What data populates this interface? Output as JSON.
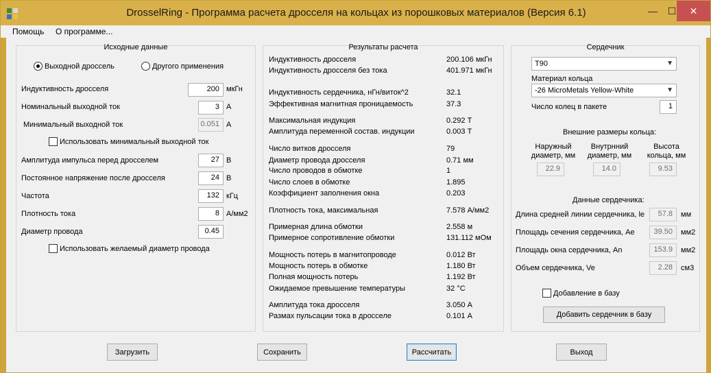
{
  "window": {
    "title": "DrosselRing - Программа расчета дросселя на кольцах из порошковых материалов (Версия 6.1)"
  },
  "menu": [
    "Помощь",
    "О программе..."
  ],
  "input": {
    "title": "Исходные данные",
    "radio_output": "Выходной дроссель",
    "radio_other": "Другого применения",
    "inductance_label": "Индуктивность  дросселя",
    "inductance_value": "200",
    "inductance_unit": "мкГн",
    "nom_current_label": "Номинальный выходной ток",
    "nom_current_value": "3",
    "nom_current_unit": "А",
    "min_current_label": "Минимальный выходной ток",
    "min_current_value": "0.051",
    "min_current_unit": "А",
    "use_min_current": "Использовать минимальный выходной ток",
    "pulse_amp_label": "Амплитуда импульса перед дросселем",
    "pulse_amp_value": "27",
    "pulse_amp_unit": "В",
    "dc_voltage_label": "Постоянное напряжение после дросселя",
    "dc_voltage_value": "24",
    "dc_voltage_unit": "В",
    "freq_label": "Частота",
    "freq_value": "132",
    "freq_unit": "кГц",
    "density_label": "Плотность тока",
    "density_value": "8",
    "density_unit": "А/мм2",
    "wire_label": "Диаметр провода",
    "wire_value": "0.45",
    "use_wire": "Использовать желаемый диаметр провода"
  },
  "results": {
    "title": "Результаты расчета",
    "rows": [
      {
        "label": "Индуктивность дросселя",
        "value": "200.106 мкГн"
      },
      {
        "label": "Индуктивность дросселя без тока",
        "value": "401.971 мкГн"
      },
      {
        "label": "Индуктивность сердечника, нГн/виток^2",
        "value": "32.1"
      },
      {
        "label": "Эффективная магнитная проницаемость",
        "value": "37.3"
      },
      {
        "label": "Максимальная индукция",
        "value": "0.292 Т"
      },
      {
        "label": "Амплитуда переменной состав. индукции",
        "value": "0.003 Т"
      },
      {
        "label": "Число витков дросселя",
        "value": "79"
      },
      {
        "label": "Диаметр провода дросселя",
        "value": "0.71 мм"
      },
      {
        "label": "Число проводов в обмотке",
        "value": "1"
      },
      {
        "label": "Число слоев в обмотке",
        "value": "1.895"
      },
      {
        "label": "Коэффициент заполнения окна",
        "value": "0.203"
      },
      {
        "label": "Плотность тока, максимальная",
        "value": "7.578 А/мм2"
      },
      {
        "label": "Примерная длина обмотки",
        "value": "2.558 м"
      },
      {
        "label": "Примерное сопротивление обмотки",
        "value": "131.112 мОм"
      },
      {
        "label": "Мощность потерь в магнитопроводе",
        "value": "0.012 Вт"
      },
      {
        "label": "Мощность потерь в обмотке",
        "value": "1.180 Вт"
      },
      {
        "label": "Полная мощность потерь",
        "value": "1.192 Вт"
      },
      {
        "label": "Ожидаемое превышение температуры",
        "value": "32 °C"
      },
      {
        "label": "Амплитуда тока дросселя",
        "value": "3.050 А"
      },
      {
        "label": "Размах пульсации тока в дросселе",
        "value": "0.101 А"
      }
    ]
  },
  "core": {
    "title": "Сердечник",
    "core_select": "T90",
    "material_label": "Материал кольца",
    "material_select": "-26 MicroMetals Yellow-White",
    "rings_label": "Число колец в пакете",
    "rings_value": "1",
    "dims_title": "Внешние размеры кольца:",
    "outer_label_1": "Наружный",
    "outer_label_2": "диаметр, мм",
    "outer_value": "22.9",
    "inner_label_1": "Внутрнний",
    "inner_label_2": "диаметр, мм",
    "inner_value": "14.0",
    "height_label_1": "Высота",
    "height_label_2": "кольца, мм",
    "height_value": "9.53",
    "data_title": "Данные сердечника:",
    "le_label": "Длина средней линии сердечника, le",
    "le_value": "57.8",
    "le_unit": "мм",
    "ae_label": "Площадь сечения сердечника, Ae",
    "ae_value": "39.50",
    "ae_unit": "мм2",
    "an_label": "Площадь окна сердечника, An",
    "an_value": "153.9",
    "an_unit": "мм2",
    "ve_label": "Объем сердечника, Ve",
    "ve_value": "2.28",
    "ve_unit": "см3",
    "add_to_db": "Добавление в базу",
    "add_core_button": "Добавить сердечник в базу"
  },
  "buttons": {
    "load": "Загрузить",
    "save": "Сохранить",
    "calc": "Рассчитать",
    "exit": "Выход"
  }
}
